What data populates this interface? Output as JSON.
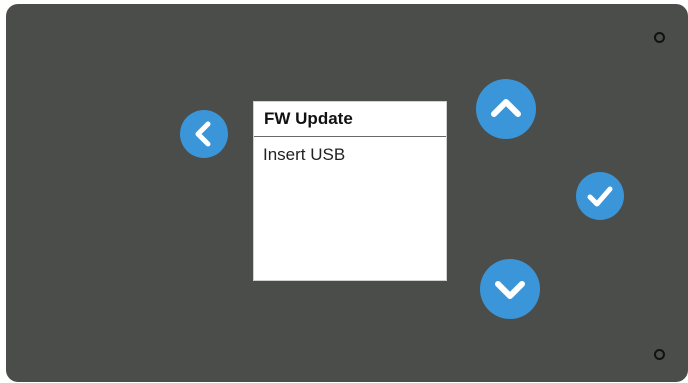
{
  "screen": {
    "title": "FW Update",
    "message": "Insert USB"
  },
  "buttons": {
    "back": {
      "icon": "chevron-left-icon"
    },
    "up": {
      "icon": "chevron-up-icon"
    },
    "down": {
      "icon": "chevron-down-icon"
    },
    "confirm": {
      "icon": "checkmark-icon"
    }
  },
  "colors": {
    "panel": "#4b4d4a",
    "button": "#3a96d8",
    "screen": "#ffffff"
  }
}
